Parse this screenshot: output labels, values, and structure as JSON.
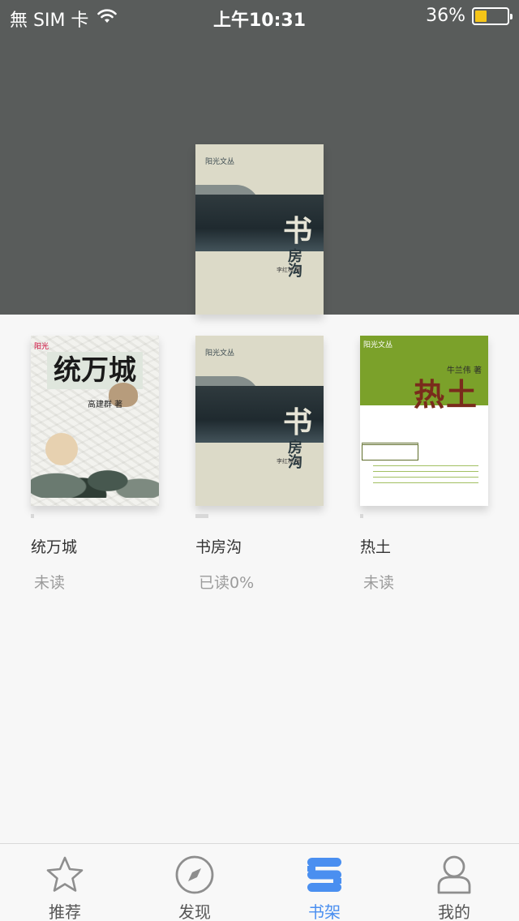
{
  "status_bar": {
    "carrier": "無 SIM 卡",
    "time": "上午10:31",
    "battery_percent": "36%",
    "battery_level": 0.36,
    "battery_color": "#f5c518"
  },
  "header": {
    "background_color": "#595c5b",
    "featured_book": {
      "cover_logo": "阳光文丛",
      "cover_title_large": "书",
      "cover_title_small": "房沟",
      "cover_author": "李红林 著"
    }
  },
  "books": [
    {
      "title": "统万城",
      "status": "未读",
      "progress": 0,
      "cover": {
        "logo": "阳光",
        "title": "统万城",
        "author": "高建群 著"
      }
    },
    {
      "title": "书房沟",
      "status": "已读0%",
      "progress": 0.1,
      "cover": {
        "logo": "阳光文丛",
        "title_large": "书",
        "title_small": "房沟",
        "author": "李红林 著"
      }
    },
    {
      "title": "热土",
      "status": "未读",
      "progress": 0,
      "cover": {
        "logo": "阳光文丛",
        "title": "热土",
        "author": "牛兰伟 著"
      }
    }
  ],
  "tabbar": {
    "active_color": "#4a8ff0",
    "tabs": [
      {
        "label": "推荐",
        "icon": "star-icon",
        "active": false
      },
      {
        "label": "发现",
        "icon": "compass-icon",
        "active": false
      },
      {
        "label": "书架",
        "icon": "bookshelf-icon",
        "active": true
      },
      {
        "label": "我的",
        "icon": "person-icon",
        "active": false
      }
    ]
  }
}
